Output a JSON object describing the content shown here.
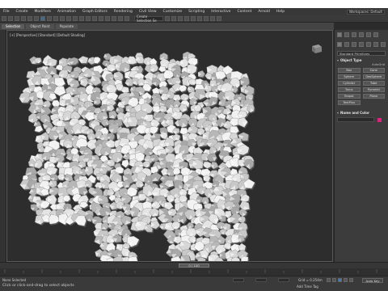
{
  "menubar": {
    "items": [
      "File",
      "Create",
      "Modifiers",
      "Animation",
      "Graph Editors",
      "Rendering",
      "Civil View",
      "Customize",
      "Scripting",
      "Interactive",
      "Content",
      "Arnold",
      "Help"
    ],
    "workspace_value": "Workspaces: Default"
  },
  "toolbar": {
    "selection_set_placeholder": "Create Selection Se"
  },
  "ribbon": {
    "tabs": [
      "Selection",
      "Object Paint",
      "Populate"
    ]
  },
  "viewport": {
    "label": "[+] [Perspective] [Standard] [Default Shading]"
  },
  "command_panel": {
    "dropdown": "Standard Primitives",
    "object_type_title": "Object Type",
    "autogrid": "AutoGrid",
    "object_buttons": [
      "Box",
      "Cone",
      "Sphere",
      "GeoSphere",
      "Cylinder",
      "Tube",
      "Torus",
      "Pyramid",
      "Teapot",
      "Plane",
      "TextPlus"
    ],
    "name_color_title": "Name and Color",
    "accent_color": "#e0227e"
  },
  "timeline": {
    "frame": "0 / 100"
  },
  "statusbar": {
    "status": "None Selected",
    "prompt": "Click or click-and-drag to select objects",
    "grid": "Grid = 0.254m",
    "add_time_tag": "Add Time Tag",
    "auto_key": "Auto Key"
  },
  "colors": {
    "background": "#2d2d2d",
    "rock": "#e4e4e4"
  }
}
